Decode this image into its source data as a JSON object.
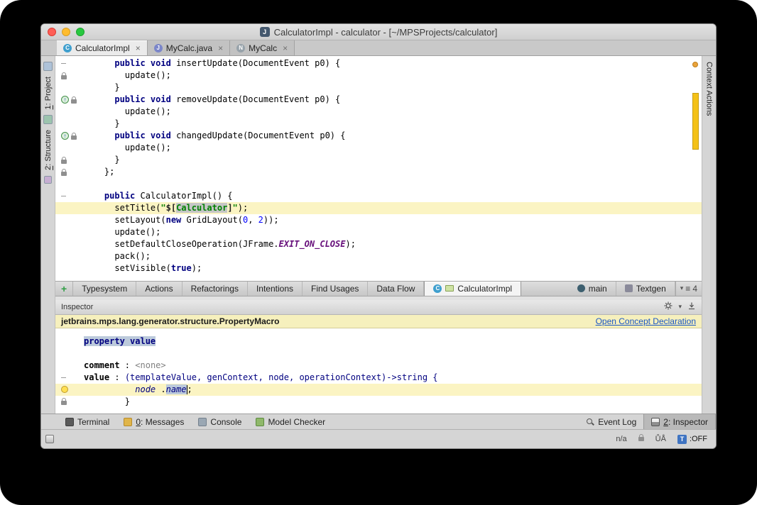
{
  "titlebar": {
    "icon_letter": "J",
    "title": "CalculatorImpl - calculator - [~/MPSProjects/calculator]"
  },
  "editor_tabs": [
    {
      "label": "CalculatorImpl",
      "icon": "class-icon",
      "icon_letter": "C",
      "icon_color": "#3f9fce",
      "close": "×",
      "active": true
    },
    {
      "label": "MyCalc.java",
      "icon": "java-file-icon",
      "icon_letter": "J",
      "icon_color": "#7b86c9",
      "close": "×",
      "active": false
    },
    {
      "label": "MyCalc",
      "icon": "node-icon",
      "icon_letter": "N",
      "icon_color": "#97a2aa",
      "close": "×",
      "active": false
    }
  ],
  "left_strip": [
    {
      "type": "icon",
      "name": "project-tool-icon"
    },
    {
      "type": "label",
      "num": "1",
      "rest": ": Project"
    },
    {
      "type": "icon",
      "name": "structure-tool-icon"
    },
    {
      "type": "label",
      "num": "2",
      "rest": ": Structure"
    },
    {
      "type": "icon",
      "name": "favorites-tool-icon"
    }
  ],
  "right_strip": [
    {
      "label": "Context Actions"
    }
  ],
  "editor": {
    "lines": [
      {
        "g": [
          "fold"
        ],
        "t": [
          [
            "      ",
            "p"
          ],
          [
            "public void",
            "k"
          ],
          [
            " insertUpdate(DocumentEvent p0) {",
            "p"
          ]
        ]
      },
      {
        "g": [
          "lock"
        ],
        "t": [
          [
            "        update();",
            "p"
          ]
        ]
      },
      {
        "g": [],
        "t": [
          [
            "      }",
            "p"
          ]
        ]
      },
      {
        "g": [
          "ovr",
          "lock"
        ],
        "t": [
          [
            "      ",
            "p"
          ],
          [
            "public void",
            "k"
          ],
          [
            " removeUpdate(DocumentEvent p0) {",
            "p"
          ]
        ]
      },
      {
        "g": [],
        "t": [
          [
            "        update();",
            "p"
          ]
        ]
      },
      {
        "g": [],
        "t": [
          [
            "      }",
            "p"
          ]
        ]
      },
      {
        "g": [
          "ovr",
          "lock"
        ],
        "t": [
          [
            "      ",
            "p"
          ],
          [
            "public void",
            "k"
          ],
          [
            " changedUpdate(DocumentEvent p0) {",
            "p"
          ]
        ]
      },
      {
        "g": [],
        "t": [
          [
            "        update();",
            "p"
          ]
        ]
      },
      {
        "g": [
          "lock"
        ],
        "t": [
          [
            "      }",
            "p"
          ]
        ]
      },
      {
        "g": [
          "lock"
        ],
        "t": [
          [
            "    };",
            "p"
          ]
        ]
      },
      {
        "g": [],
        "t": []
      },
      {
        "g": [
          "fold"
        ],
        "t": [
          [
            "    ",
            "p"
          ],
          [
            "public",
            "k"
          ],
          [
            " CalculatorImpl() {",
            "p"
          ]
        ]
      },
      {
        "g": [],
        "hl": true,
        "t": [
          [
            "      setTitle(",
            "p"
          ],
          [
            "\"",
            "s"
          ],
          [
            "$[",
            "md"
          ],
          [
            "Calculator",
            "mac"
          ],
          [
            "]",
            "md"
          ],
          [
            "\"",
            "s"
          ],
          [
            ");",
            "p"
          ]
        ]
      },
      {
        "g": [],
        "t": [
          [
            "      setLayout(",
            "p"
          ],
          [
            "new",
            "k"
          ],
          [
            " GridLayout(",
            "p"
          ],
          [
            "0",
            "n"
          ],
          [
            ", ",
            "p"
          ],
          [
            "2",
            "n"
          ],
          [
            "));",
            "p"
          ]
        ]
      },
      {
        "g": [],
        "t": [
          [
            "      update();",
            "p"
          ]
        ]
      },
      {
        "g": [],
        "t": [
          [
            "      setDefaultCloseOperation(JFrame.",
            "p"
          ],
          [
            "EXIT_ON_CLOSE",
            "cst"
          ],
          [
            ");",
            "p"
          ]
        ]
      },
      {
        "g": [],
        "t": [
          [
            "      pack();",
            "p"
          ]
        ]
      },
      {
        "g": [],
        "t": [
          [
            "      setVisible(",
            "p"
          ],
          [
            "true",
            "k"
          ],
          [
            ");",
            "p"
          ]
        ]
      }
    ]
  },
  "tool_tabs": {
    "plus_label": "+",
    "tabs": [
      "Typesystem",
      "Actions",
      "Refactorings",
      "Intentions",
      "Find Usages",
      "Data Flow"
    ],
    "active_tab": {
      "icon_letter": "C",
      "label": "CalculatorImpl"
    },
    "right_tabs": [
      {
        "label": "main"
      },
      {
        "label": "Textgen"
      }
    ],
    "overflow_count": "4"
  },
  "inspector": {
    "title": "Inspector",
    "banner_text": "jetbrains.mps.lang.generator.structure.PropertyMacro",
    "banner_link": "Open Concept Declaration",
    "lines": [
      {
        "g": [],
        "t": [
          [
            "property value",
            "psel"
          ]
        ]
      },
      {
        "g": [],
        "t": []
      },
      {
        "g": [],
        "t": [
          [
            "comment",
            "b"
          ],
          [
            " : ",
            "p"
          ],
          [
            "<none>",
            "gray"
          ]
        ]
      },
      {
        "g": [
          "fold"
        ],
        "t": [
          [
            "value",
            "b"
          ],
          [
            " : ",
            "p"
          ],
          [
            "(templateValue, genContext, node, operationContext)->string {",
            "nav"
          ]
        ]
      },
      {
        "g": [
          "bulb"
        ],
        "hl": true,
        "t": [
          [
            "          ",
            "p"
          ],
          [
            "node",
            "it"
          ],
          [
            " .",
            "p"
          ],
          [
            "name",
            "namesel"
          ],
          [
            "",
            "caret"
          ],
          [
            ";",
            "p"
          ]
        ]
      },
      {
        "g": [
          "lock"
        ],
        "t": [
          [
            "        }",
            "p"
          ]
        ]
      }
    ]
  },
  "status_bar": {
    "left": [
      {
        "icon": "terminal-icon",
        "icls": "ic-terminal",
        "label": "Terminal"
      },
      {
        "icon": "messages-icon",
        "icls": "ic-messages",
        "num": "0",
        "rest": ": Messages"
      },
      {
        "icon": "console-icon",
        "icls": "ic-console",
        "label": "Console"
      },
      {
        "icon": "model-checker-icon",
        "icls": "ic-modelchecker",
        "label": "Model Checker"
      }
    ],
    "right": [
      {
        "icon": "event-log-icon",
        "icls": "ic-mag",
        "label": "Event Log"
      },
      {
        "icon": "inspector-tab-icon",
        "icls": "ic-sq ic-inspector",
        "num": "2",
        "rest": ": Inspector",
        "active": true
      }
    ]
  },
  "bottom_bar": {
    "position": "n/a",
    "indicator": "ŮÅ",
    "toggle_letter": "T",
    "toggle_state": ":OFF"
  },
  "colors": {
    "current_line": "#fbf4c3",
    "banner_bg": "#f6f0bd",
    "keyword": "#000080",
    "string": "#008000",
    "constant": "#660e7a",
    "selection_unfocused": "#bccadb",
    "error_stripe": "#f4c117"
  }
}
